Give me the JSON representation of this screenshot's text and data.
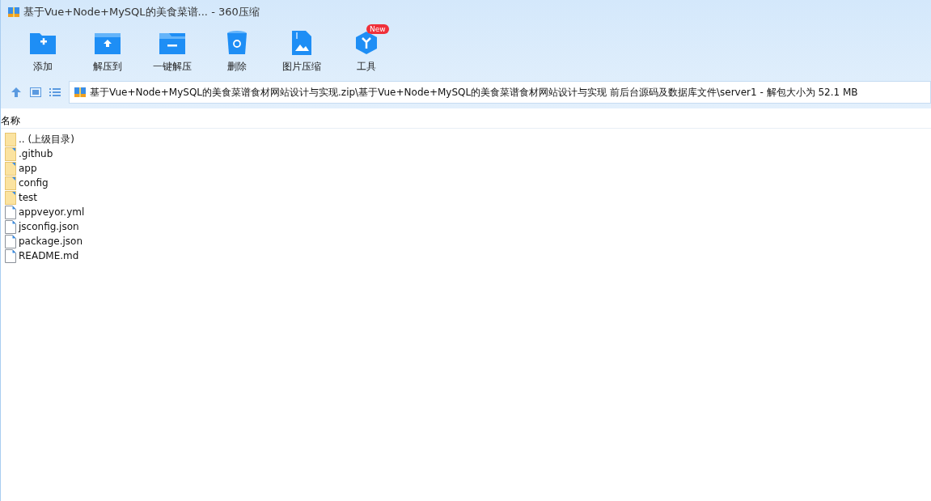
{
  "window": {
    "title": "基于Vue+Node+MySQL的美食菜谱... - 360压缩"
  },
  "toolbar": [
    {
      "kind": "add",
      "label": "添加"
    },
    {
      "kind": "extract",
      "label": "解压到"
    },
    {
      "kind": "oneclick",
      "label": "一键解压"
    },
    {
      "kind": "delete",
      "label": "删除"
    },
    {
      "kind": "image",
      "label": "图片压缩"
    },
    {
      "kind": "tools",
      "label": "工具",
      "badge": "New"
    }
  ],
  "address": {
    "path": "基于Vue+Node+MySQL的美食菜谱食材网站设计与实现.zip\\基于Vue+Node+MySQL的美食菜谱食材网站设计与实现 前后台源码及数据库文件\\server1 - 解包大小为 52.1 MB"
  },
  "table": {
    "columns": [
      "名称"
    ],
    "rows": [
      {
        "kind": "parent",
        "name": ".. (上级目录)"
      },
      {
        "kind": "folder",
        "name": ".github"
      },
      {
        "kind": "folder",
        "name": "app"
      },
      {
        "kind": "folder",
        "name": "config"
      },
      {
        "kind": "folder",
        "name": "test"
      },
      {
        "kind": "file",
        "name": "appveyor.yml"
      },
      {
        "kind": "file",
        "name": "jsconfig.json"
      },
      {
        "kind": "file",
        "name": "package.json"
      },
      {
        "kind": "file",
        "name": "README.md"
      }
    ]
  }
}
